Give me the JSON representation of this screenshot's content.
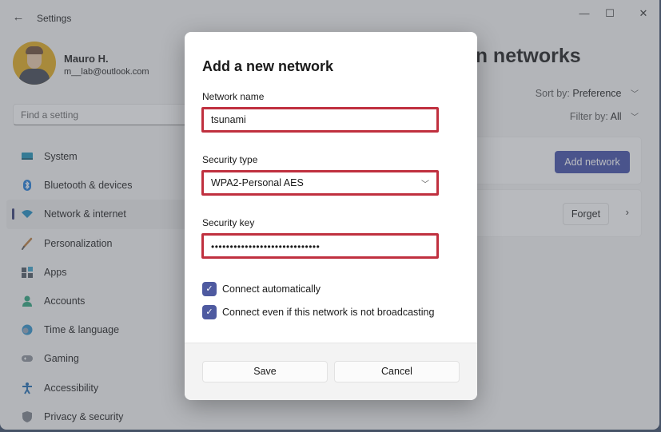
{
  "window": {
    "app_title": "Settings",
    "back_icon": "arrow-left-icon",
    "controls": {
      "minimize": "—",
      "maximize": "☐",
      "close": "✕"
    }
  },
  "profile": {
    "name": "Mauro H.",
    "email": "m__lab@outlook.com"
  },
  "search": {
    "placeholder": "Find a setting"
  },
  "sidebar": {
    "items": [
      {
        "label": "System",
        "icon": "system-icon",
        "active": false
      },
      {
        "label": "Bluetooth & devices",
        "icon": "bluetooth-icon",
        "active": false
      },
      {
        "label": "Network & internet",
        "icon": "wifi-icon",
        "active": true
      },
      {
        "label": "Personalization",
        "icon": "brush-icon",
        "active": false
      },
      {
        "label": "Apps",
        "icon": "apps-icon",
        "active": false
      },
      {
        "label": "Accounts",
        "icon": "person-icon",
        "active": false
      },
      {
        "label": "Time & language",
        "icon": "globe-clock-icon",
        "active": false
      },
      {
        "label": "Gaming",
        "icon": "gamepad-icon",
        "active": false
      },
      {
        "label": "Accessibility",
        "icon": "accessibility-icon",
        "active": false
      },
      {
        "label": "Privacy & security",
        "icon": "shield-icon",
        "active": false
      }
    ]
  },
  "main": {
    "page_title_visible": "own networks",
    "sort": {
      "label": "Sort by:",
      "value": "Preference"
    },
    "filter": {
      "label": "Filter by:",
      "value": "All"
    },
    "add_network_label": "Add network",
    "forget_label": "Forget"
  },
  "dialog": {
    "title": "Add a new network",
    "network_name": {
      "label": "Network name",
      "value": "tsunami"
    },
    "security_type": {
      "label": "Security type",
      "value": "WPA2-Personal AES"
    },
    "security_key": {
      "label": "Security key",
      "masked_value": "•••••••••••••••••••••••••••••"
    },
    "checkboxes": [
      {
        "label": "Connect automatically",
        "checked": true
      },
      {
        "label": "Connect even if this network is not broadcasting",
        "checked": true
      }
    ],
    "save_label": "Save",
    "cancel_label": "Cancel"
  },
  "colors": {
    "accent": "#3e4ca5",
    "highlight_border": "#c0303f",
    "checkbox": "#4e5aa0"
  }
}
